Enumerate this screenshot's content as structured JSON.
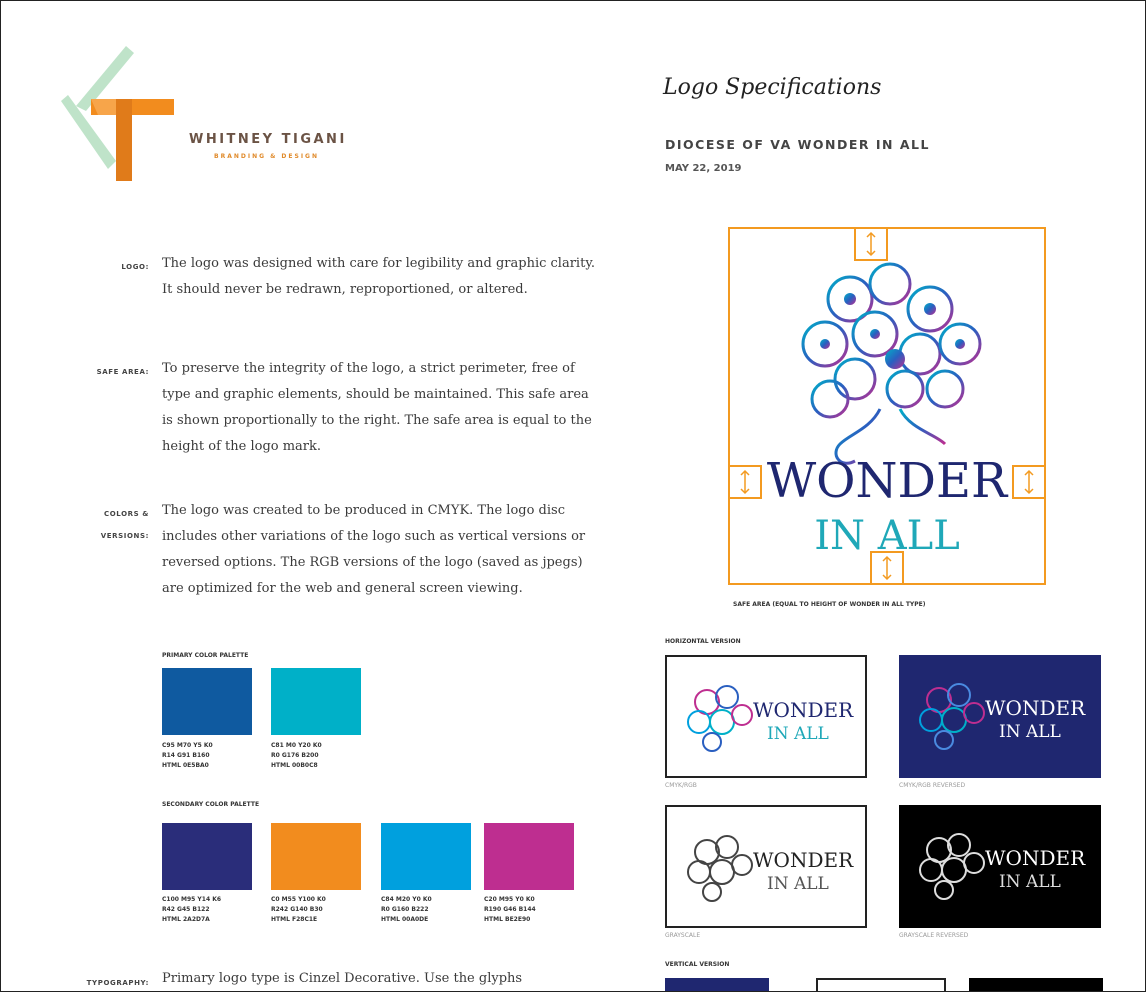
{
  "brand": {
    "name": "WHITNEY TIGANI",
    "sub": "BRANDING & DESIGN"
  },
  "header": {
    "title": "Logo Specifications",
    "doc_title": "DIOCESE OF VA WONDER IN ALL",
    "date": "MAY 22, 2019"
  },
  "sections": [
    {
      "label_lines": [
        "LOGO:"
      ],
      "text": "The logo was designed with care for legibility and graphic clarity. It should never be redrawn, reproportioned, or altered."
    },
    {
      "label_lines": [
        "SAFE AREA:"
      ],
      "text": "To preserve the integrity of the logo, a strict perimeter, free of type and graphic elements, should be maintained. This safe area is shown proportionally to the right. The safe area is equal to the height of the logo mark."
    },
    {
      "label_lines": [
        "COLORS &",
        "VERSIONS:"
      ],
      "text": "The logo was created to be produced in CMYK. The logo disc includes other variations of the logo such as vertical versions or reversed options. The RGB versions of the logo (saved as jpegs) are optimized for the web and general screen viewing."
    },
    {
      "label_lines": [
        "TYPOGRAPHY:"
      ],
      "text": "Primary logo type is Cinzel Decorative. Use the glyphs"
    }
  ],
  "palettes": {
    "primary_label": "PRIMARY COLOR PALETTE",
    "secondary_label": "SECONDARY COLOR PALETTE",
    "primary": [
      {
        "color": "#0f5aa0",
        "cmyk": "C95 M70 Y5 K0",
        "rgb": "R14 G91 B160",
        "html": "HTML 0E5BA0"
      },
      {
        "color": "#00b0c8",
        "cmyk": "C81 M0 Y20 K0",
        "rgb": "R0 G176 B200",
        "html": "HTML 00B0C8"
      }
    ],
    "secondary": [
      {
        "color": "#2a2d7a",
        "cmyk": "C100 M95 Y14 K6",
        "rgb": "R42 G45 B122",
        "html": "HTML 2A2D7A"
      },
      {
        "color": "#f28c1e",
        "cmyk": "C0 M55 Y100 K0",
        "rgb": "R242 G140 B30",
        "html": "HTML F28C1E"
      },
      {
        "color": "#00a0de",
        "cmyk": "C84 M20 Y0 K0",
        "rgb": "R0 G160 B222",
        "html": "HTML 00A0DE"
      },
      {
        "color": "#be2e90",
        "cmyk": "C20 M95 Y0 K0",
        "rgb": "R190 G46 B144",
        "html": "HTML BE2E90"
      }
    ]
  },
  "logo": {
    "line1": "WONDER",
    "line2": "IN ALL",
    "safe_caption": "SAFE AREA (EQUAL TO HEIGHT OF WONDER IN ALL TYPE)"
  },
  "versions": {
    "horizontal_label": "HORIZONTAL VERSION",
    "vertical_label": "VERTICAL VERSION",
    "items": [
      {
        "caption": "CMYK/RGB"
      },
      {
        "caption": "CMYK/RGB REVERSED"
      },
      {
        "caption": "GRAYSCALE"
      },
      {
        "caption": "GRAYSCALE REVERSED"
      }
    ]
  },
  "colors": {
    "accent_orange": "#f39a20",
    "navy": "#1f2770",
    "teal": "#1fa8b8",
    "brand_brown": "#6b5345"
  }
}
